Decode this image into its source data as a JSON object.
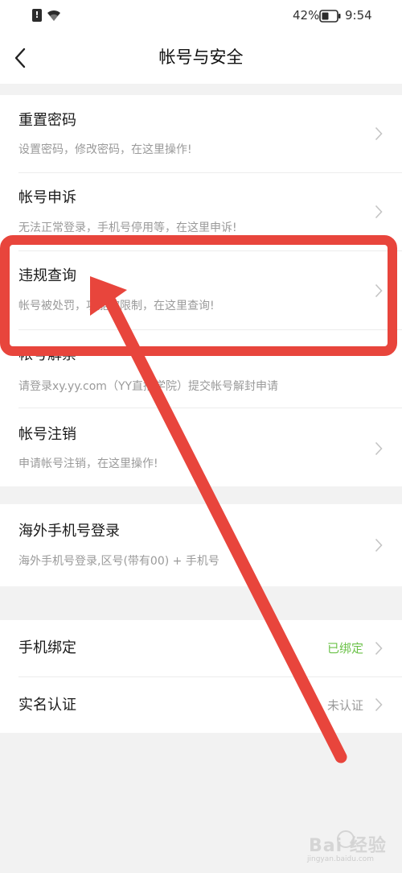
{
  "status_bar": {
    "battery_percent": "42%",
    "time": "9:54",
    "alert_glyph": "!",
    "icons": [
      "alert-icon",
      "wifi-icon",
      "battery-icon"
    ]
  },
  "header": {
    "title": "帐号与安全",
    "back_icon": "chevron-left-icon"
  },
  "groups": [
    {
      "items": [
        {
          "title": "重置密码",
          "subtitle": "设置密码，修改密码，在这里操作!"
        },
        {
          "title": "帐号申诉",
          "subtitle": "无法正常登录，手机号停用等，在这里申诉!"
        },
        {
          "title": "违规查询",
          "subtitle": "帐号被处罚，功能被限制，在这里查询!"
        },
        {
          "title": "帐号解禁",
          "subtitle": "请登录xy.yy.com（YY直播学院）提交帐号解封申请"
        },
        {
          "title": "帐号注销",
          "subtitle": "申请帐号注销，在这里操作!"
        }
      ]
    },
    {
      "items": [
        {
          "title": "海外手机号登录",
          "subtitle": "海外手机号登录,区号(带有00) + 手机号"
        }
      ]
    },
    {
      "items": [
        {
          "title": "手机绑定",
          "status": "已绑定"
        },
        {
          "title": "实名认证",
          "status": "未认证"
        }
      ]
    }
  ],
  "colors": {
    "bound_status": "#6cc24a",
    "unbound_status": "#9a9a9a",
    "highlight_box": "#e8453c",
    "arrow": "#e8453c"
  },
  "watermark": {
    "text": "Bai 经验",
    "url": "jingyan.baidu.com"
  }
}
